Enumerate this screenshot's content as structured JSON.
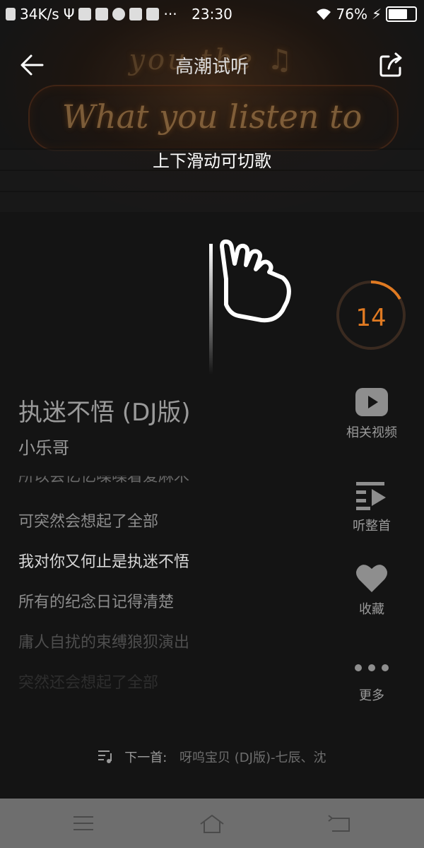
{
  "status_bar": {
    "net_speed": "34K/s",
    "time": "23:30",
    "battery": "76%",
    "battery_level": 0.76
  },
  "header": {
    "title": "高潮试听",
    "back_icon": "arrow-left-icon",
    "share_icon": "share-icon"
  },
  "background_text": {
    "line1": "you the ♫",
    "line2": "What you listen to"
  },
  "hint": "上下滑动可切歌",
  "countdown": "14",
  "song": {
    "title": "执迷不悟 (DJ版)",
    "artist": "小乐哥"
  },
  "lyrics": [
    "所以会忆忆噪噪着爱麻木",
    "可突然会想起了全部",
    "我对你又何止是执迷不悟",
    "所有的纪念日记得清楚",
    "庸人自扰的束缚狼狈演出",
    "突然还会想起了全部"
  ],
  "actions": [
    {
      "label": "相关视频",
      "icon": "play-video-icon"
    },
    {
      "label": "听整首",
      "icon": "playlist-play-icon"
    },
    {
      "label": "收藏",
      "icon": "heart-icon"
    },
    {
      "label": "更多",
      "icon": "more-dots-icon"
    }
  ],
  "next_track": {
    "prefix": "下一首:",
    "name": "呀呜宝贝 (DJ版)-七辰、沈"
  },
  "colors": {
    "accent": "#e07a22",
    "text_dim": "#9a9a9a",
    "navbar": "#6e6e6e"
  }
}
